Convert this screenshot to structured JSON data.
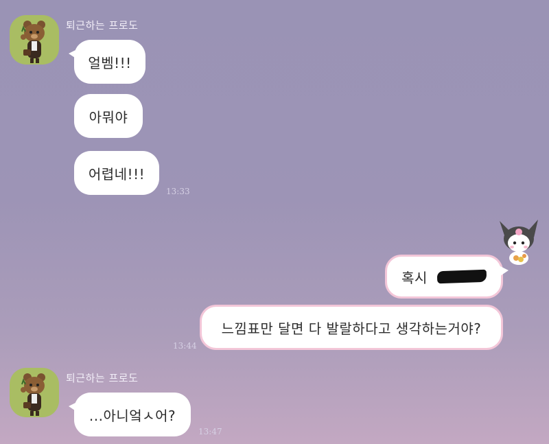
{
  "messages_group_1": {
    "sender": "퇴근하는 프로도",
    "bubbles": [
      "얼벰!!!",
      "아뭐야",
      "어렵네!!!"
    ],
    "time": "13:33"
  },
  "my_messages": {
    "bubble_1_text": "혹시",
    "bubble_2_text": "느낌표만 달면 다 발랄하다고 생각하는거야?",
    "time": "13:44",
    "bubble_border_color": "#f3c6d8"
  },
  "messages_group_2": {
    "sender": "퇴근하는 프로도",
    "bubbles": [
      "...아니엌ㅅ어?"
    ],
    "time": "13:47"
  },
  "colors": {
    "background_top": "#9a93b5",
    "background_bottom": "#c3a8c2",
    "avatar_bg": "#a9bd63",
    "bubble": "#ffffff"
  },
  "icons": {
    "friend_avatar": "bear-character-icon",
    "my_avatar": "kuromi-sticker-icon"
  }
}
